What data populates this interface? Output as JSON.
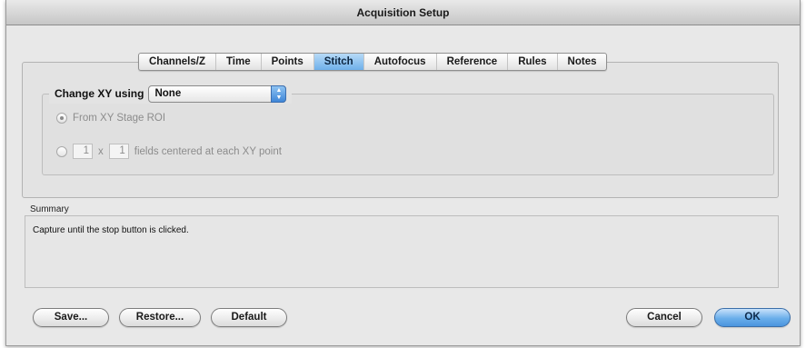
{
  "window": {
    "title": "Acquisition Setup"
  },
  "tabs": [
    {
      "label": "Channels/Z",
      "selected": false
    },
    {
      "label": "Time",
      "selected": false
    },
    {
      "label": "Points",
      "selected": false
    },
    {
      "label": "Stitch",
      "selected": true
    },
    {
      "label": "Autofocus",
      "selected": false
    },
    {
      "label": "Reference",
      "selected": false
    },
    {
      "label": "Rules",
      "selected": false
    },
    {
      "label": "Notes",
      "selected": false
    }
  ],
  "stitch": {
    "change_xy_label": "Change XY using",
    "change_xy_value": "None",
    "option_roi": {
      "label": "From XY Stage ROI",
      "selected": true
    },
    "option_fields": {
      "selected": false,
      "cols": "1",
      "times": "x",
      "rows": "1",
      "suffix": "fields centered at each XY point"
    }
  },
  "summary": {
    "label": "Summary",
    "text": "Capture until the stop button is clicked."
  },
  "buttons": {
    "save": "Save...",
    "restore": "Restore...",
    "default": "Default",
    "cancel": "Cancel",
    "ok": "OK"
  },
  "colors": {
    "selected_tab": "#6fb0ea",
    "default_button": "#4b94de"
  }
}
